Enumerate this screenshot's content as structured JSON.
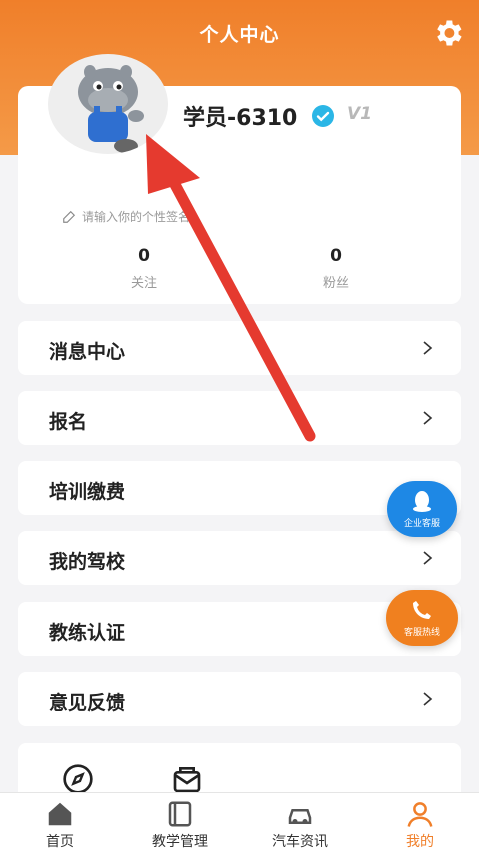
{
  "header": {
    "title": "个人中心"
  },
  "profile": {
    "username": "学员-6310",
    "level": "V1",
    "signature_placeholder": "请输入你的个性签名",
    "stats": [
      {
        "value": "0",
        "label": "关注"
      },
      {
        "value": "0",
        "label": "粉丝"
      }
    ]
  },
  "menu": [
    {
      "label": "消息中心"
    },
    {
      "label": "报名"
    },
    {
      "label": "培训缴费"
    },
    {
      "label": "我的驾校"
    },
    {
      "label": "教练认证"
    },
    {
      "label": "意见反馈"
    }
  ],
  "floating": {
    "qq_label": "企业客服",
    "phone_label": "客服热线"
  },
  "tabs": [
    {
      "label": "首页"
    },
    {
      "label": "教学管理"
    },
    {
      "label": "汽车资讯"
    },
    {
      "label": "我的"
    }
  ],
  "colors": {
    "accent": "#f07f2a",
    "qq_blue": "#1e88e5",
    "arrow_red": "#e53a2f"
  }
}
